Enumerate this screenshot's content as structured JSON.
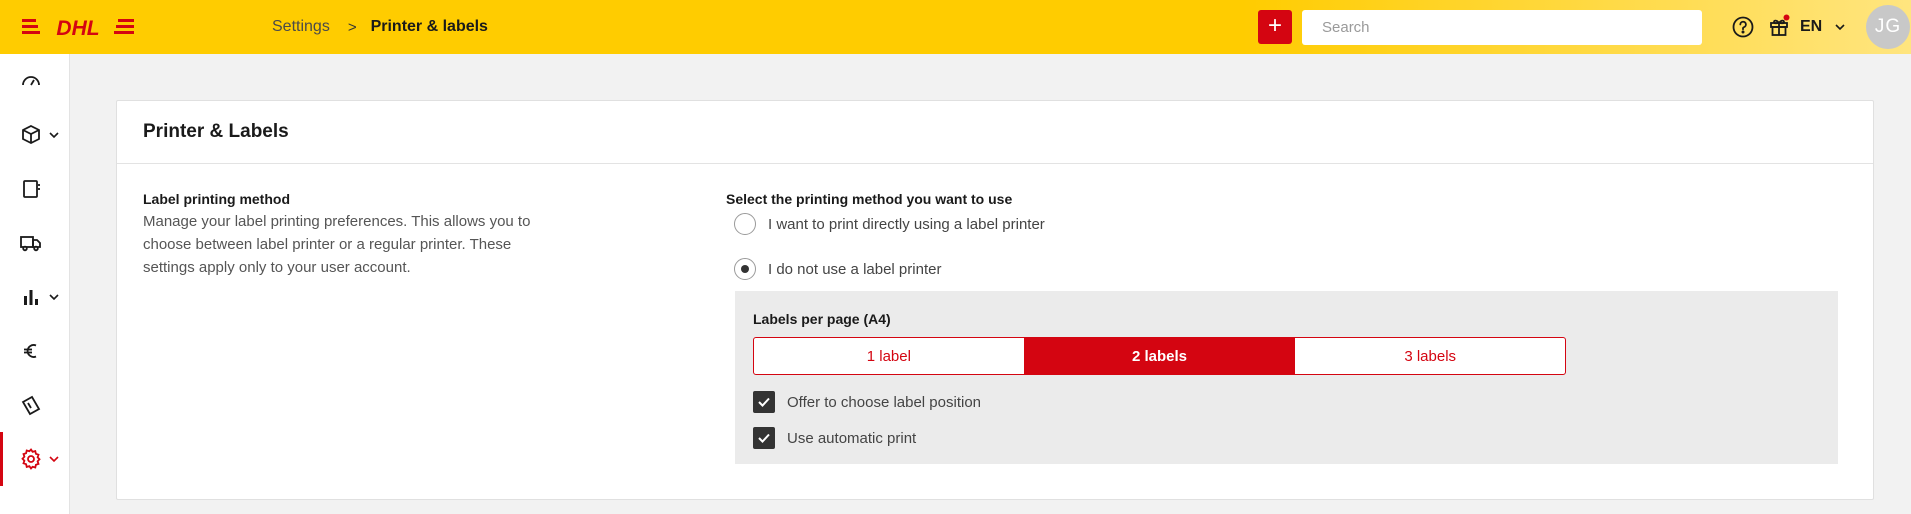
{
  "header": {
    "logo_text": "DHL",
    "add_button_label": "+",
    "search_placeholder": "Search",
    "help_icon": "question-circle-icon",
    "gift_icon": "gift-icon",
    "language": "EN",
    "avatar_initials": "JG",
    "colors": {
      "brand_yellow": "#ffcc00",
      "brand_red": "#d40511"
    }
  },
  "breadcrumb": {
    "items": [
      "Settings",
      "Printer & labels"
    ],
    "separator": ">"
  },
  "sidebar": {
    "items": [
      {
        "icon": "dashboard-gauge-icon",
        "has_chevron": false
      },
      {
        "icon": "package-icon",
        "has_chevron": true
      },
      {
        "icon": "address-book-icon",
        "has_chevron": false
      },
      {
        "icon": "truck-icon",
        "has_chevron": false
      },
      {
        "icon": "bar-chart-icon",
        "has_chevron": true
      },
      {
        "icon": "euro-icon",
        "has_chevron": false
      },
      {
        "icon": "ticket-icon",
        "has_chevron": false
      },
      {
        "icon": "gear-icon",
        "has_chevron": true,
        "active": true
      }
    ]
  },
  "page": {
    "title": "Printer & Labels",
    "left": {
      "title": "Label printing method",
      "description": "Manage your label printing preferences. This allows you to choose between label printer or a regular printer. These settings apply only to your user account."
    },
    "method": {
      "title": "Select the printing method you want to use",
      "options": [
        {
          "label": "I want to print directly using a label printer",
          "selected": false
        },
        {
          "label": "I do not use a label printer",
          "selected": true
        }
      ]
    },
    "labels_per_page": {
      "title": "Labels per page (A4)",
      "options": [
        "1 label",
        "2 labels",
        "3 labels"
      ],
      "selected": "2 labels"
    },
    "checkboxes": [
      {
        "label": "Offer to choose label position",
        "checked": true
      },
      {
        "label": "Use automatic print",
        "checked": true
      }
    ]
  }
}
